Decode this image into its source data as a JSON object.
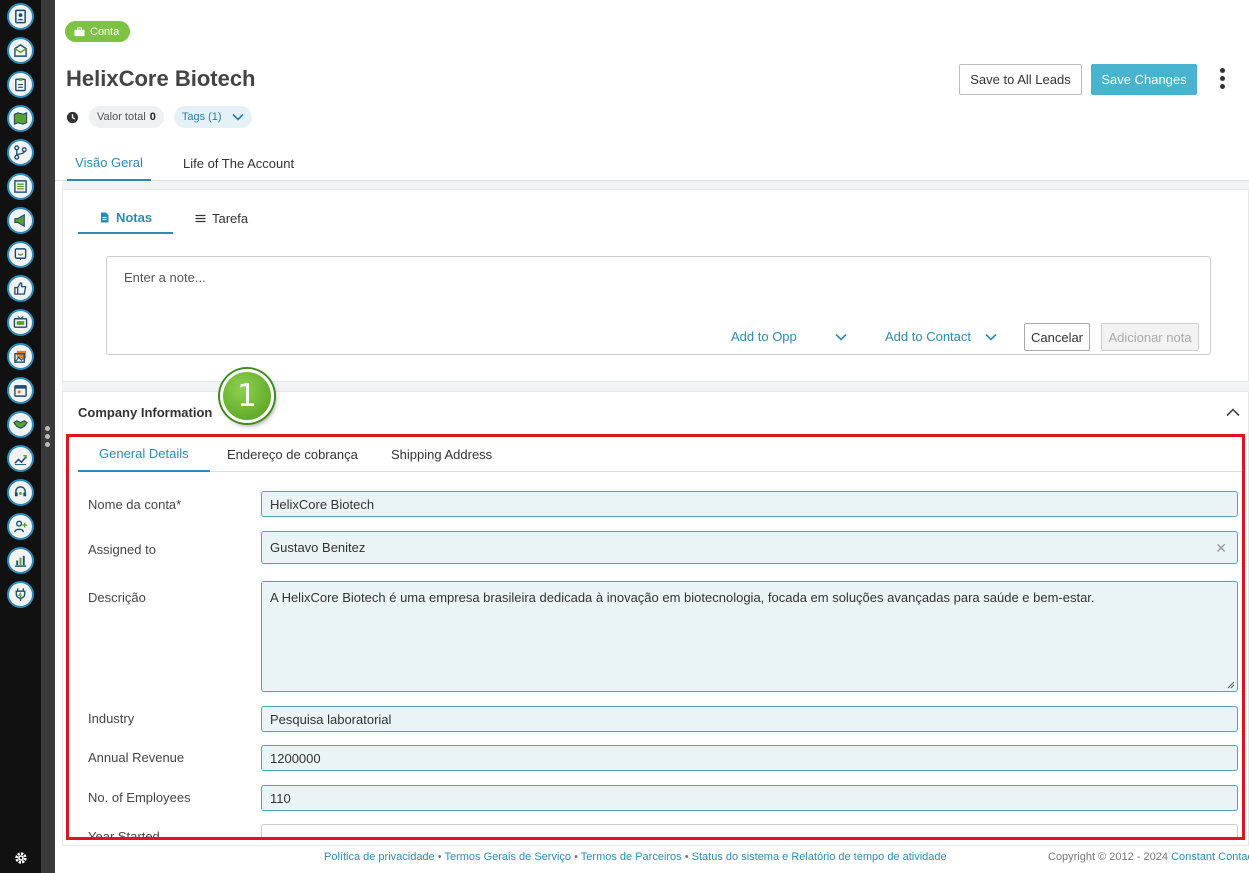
{
  "header": {
    "badge": "Conta",
    "title": "HelixCore Biotech",
    "valor_label": "Valor total",
    "valor_value": "0",
    "tags_label": "Tags (1)",
    "save_all_label": "Save to All Leads",
    "save_changes_label": "Save Changes"
  },
  "tabs": [
    "Visão Geral",
    "Life of The Account"
  ],
  "notes": {
    "tabs": [
      "Notas",
      "Tarefa"
    ],
    "placeholder": "Enter a note...",
    "add_to_opp": "Add to Opp",
    "add_to_contact": "Add to Contact",
    "cancel": "Cancelar",
    "add_note": "Adicionar nota"
  },
  "company": {
    "title": "Company Information",
    "marker": "1",
    "tabs": [
      "General Details",
      "Endereço de cobrança",
      "Shipping Address"
    ],
    "fields": {
      "account_name": {
        "label": "Nome da conta*",
        "value": "HelixCore Biotech"
      },
      "assigned_to": {
        "label": "Assigned to",
        "value": "Gustavo Benitez"
      },
      "description": {
        "label": "Descrição",
        "value": "A HelixCore Biotech é uma empresa brasileira dedicada à inovação em biotecnologia, focada em soluções avançadas para saúde e bem-estar."
      },
      "industry": {
        "label": "Industry",
        "value": "Pesquisa laboratorial"
      },
      "annual_revenue": {
        "label": "Annual Revenue",
        "value": "1200000"
      },
      "employees": {
        "label": "No. of Employees",
        "value": "110"
      },
      "year_started": {
        "label": "Year Started",
        "value": ""
      }
    }
  },
  "footer": {
    "links": [
      "Política de privacidade",
      "Termos Gerais de Serviço",
      "Termos de Parceiros",
      "Status do sistema e Relatório de tempo de atividade"
    ],
    "separator": "•",
    "copyright": "Copyright © 2012 - 2024",
    "brand": "Constant Contact"
  },
  "sidebar_icons": [
    "contacts-icon",
    "email-icon",
    "clipboard-icon",
    "map-icon",
    "pipeline-icon",
    "list-icon",
    "megaphone-icon",
    "chat-icon",
    "thumbs-up-icon",
    "tv-icon",
    "gallery-icon",
    "calendar-icon",
    "handshake-icon",
    "trend-icon",
    "support-icon",
    "add-user-icon",
    "bar-chart-icon",
    "plug-icon",
    "gear-icon"
  ],
  "colors": {
    "accent": "#2b8ab5",
    "primary_button": "#47b3cf",
    "badge": "#7cc243",
    "highlight": "#e0141c"
  }
}
